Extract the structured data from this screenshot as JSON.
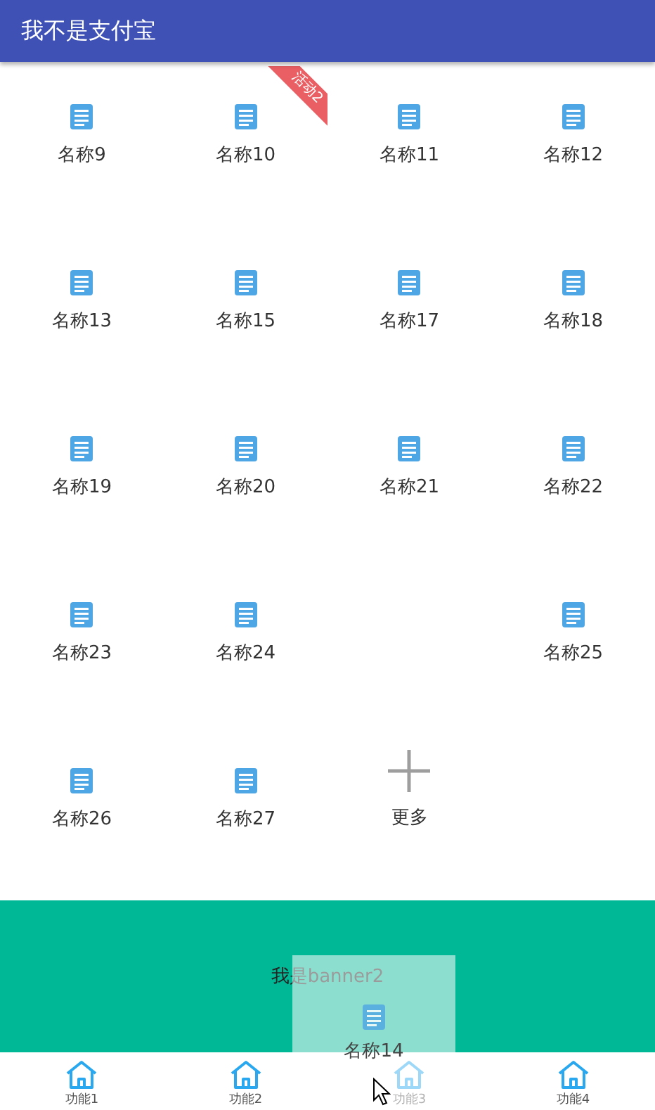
{
  "app_bar": {
    "title": "我不是支付宝"
  },
  "grid": [
    {
      "kind": "item",
      "label": "名称9"
    },
    {
      "kind": "item",
      "label": "名称10",
      "ribbon": "活动2"
    },
    {
      "kind": "item",
      "label": "名称11"
    },
    {
      "kind": "item",
      "label": "名称12"
    },
    {
      "kind": "item",
      "label": "名称13"
    },
    {
      "kind": "item",
      "label": "名称15"
    },
    {
      "kind": "item",
      "label": "名称17"
    },
    {
      "kind": "item",
      "label": "名称18"
    },
    {
      "kind": "item",
      "label": "名称19"
    },
    {
      "kind": "item",
      "label": "名称20"
    },
    {
      "kind": "item",
      "label": "名称21"
    },
    {
      "kind": "item",
      "label": "名称22"
    },
    {
      "kind": "item",
      "label": "名称23"
    },
    {
      "kind": "item",
      "label": "名称24"
    },
    {
      "kind": "empty"
    },
    {
      "kind": "item",
      "label": "名称25"
    },
    {
      "kind": "item",
      "label": "名称26"
    },
    {
      "kind": "item",
      "label": "名称27"
    },
    {
      "kind": "more",
      "label": "更多"
    }
  ],
  "banner": {
    "text": "我是banner2"
  },
  "dragged_item": {
    "label": "名称14"
  },
  "tabs": [
    {
      "label": "功能1"
    },
    {
      "label": "功能2"
    },
    {
      "label": "功能3"
    },
    {
      "label": "功能4"
    }
  ]
}
